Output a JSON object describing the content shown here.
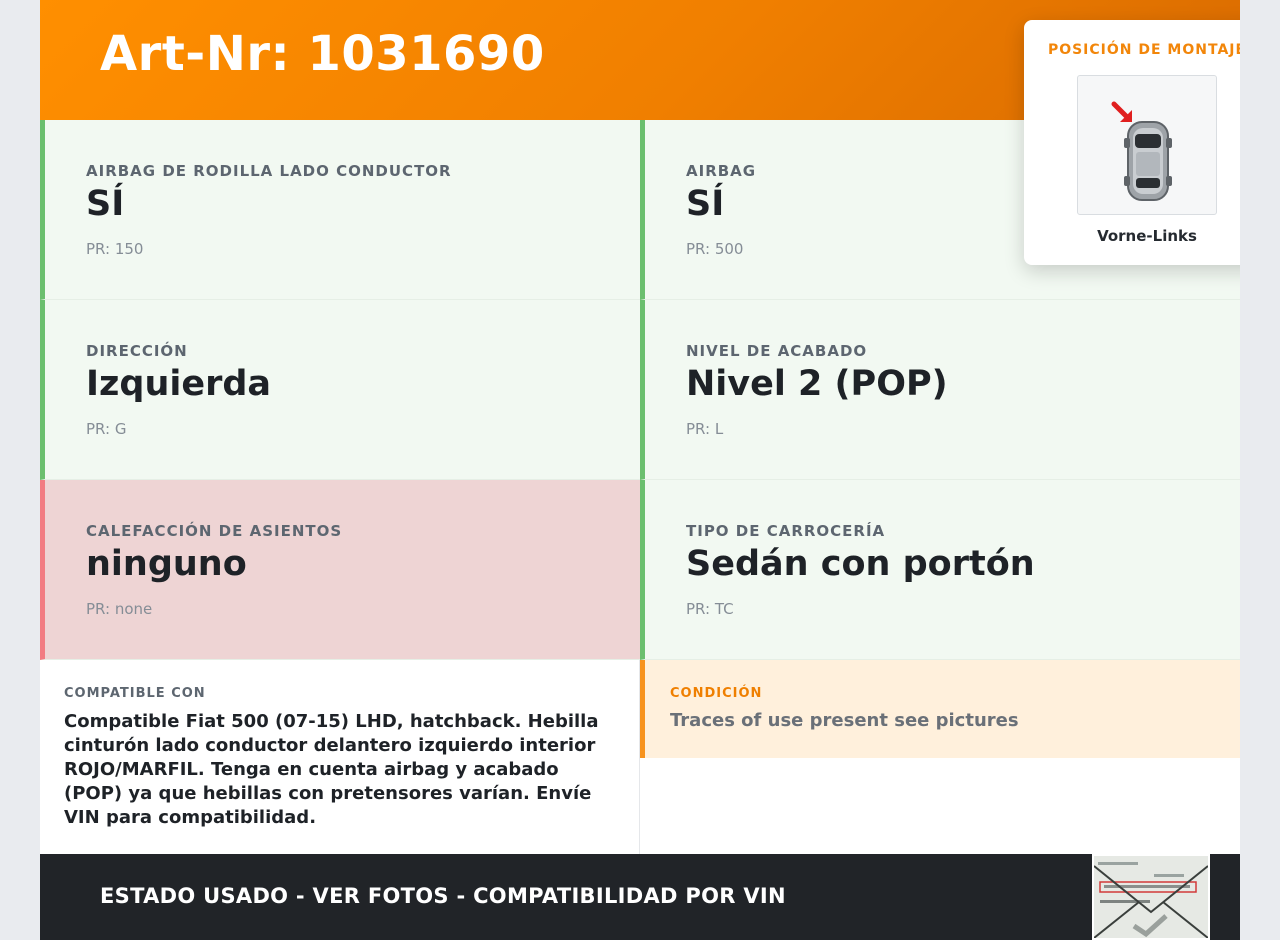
{
  "header": {
    "title": "Art-Nr: 1031690"
  },
  "specs": [
    {
      "label": "AIRBAG DE RODILLA LADO CONDUCTOR",
      "value": "SÍ",
      "pr": "PR: 150",
      "status": "ok"
    },
    {
      "label": "AIRBAG",
      "value": "SÍ",
      "pr": "PR: 500",
      "status": "ok"
    },
    {
      "label": "DIRECCIÓN",
      "value": "Izquierda",
      "pr": "PR: G",
      "status": "ok"
    },
    {
      "label": "NIVEL DE ACABADO",
      "value": "Nivel 2 (POP)",
      "pr": "PR: L",
      "status": "ok"
    },
    {
      "label": "CALEFACCIÓN DE ASIENTOS",
      "value": "ninguno",
      "pr": "PR: none",
      "status": "bad"
    },
    {
      "label": "TIPO DE CARROCERÍA",
      "value": "Sedán con portón",
      "pr": "PR: TC",
      "status": "ok"
    }
  ],
  "compatible": {
    "label": "COMPATIBLE CON",
    "text": "Compatible Fiat 500 (07-15) LHD, hatchback. Hebilla cinturón lado conductor delantero izquierdo interior ROJO/MARFIL. Tenga en cuenta airbag y acabado (POP) ya que hebillas con pretensores varían. Envíe VIN para compatibilidad."
  },
  "condition": {
    "label": "CONDICIÓN",
    "text": "Traces of use present see pictures"
  },
  "footer": {
    "text": "ESTADO USADO - VER FOTOS - COMPATIBILIDAD POR VIN"
  },
  "mounting": {
    "title": "POSICIÓN DE MONTAJE",
    "caption": "Vorne-Links"
  },
  "colors": {
    "header_orange": "#ff8f00",
    "ok_border": "#6bbf6e",
    "ok_bg": "#f2f9f2",
    "bad_border": "#f27c82",
    "bad_bg": "#eed4d4",
    "condition_accent": "#f7931e",
    "footer_bg": "#212428"
  },
  "icons": {
    "mount_image": "car-top-view-icon",
    "mount_arrow": "arrow-front-left-icon",
    "document": "vehicle-document-thumbnail"
  }
}
